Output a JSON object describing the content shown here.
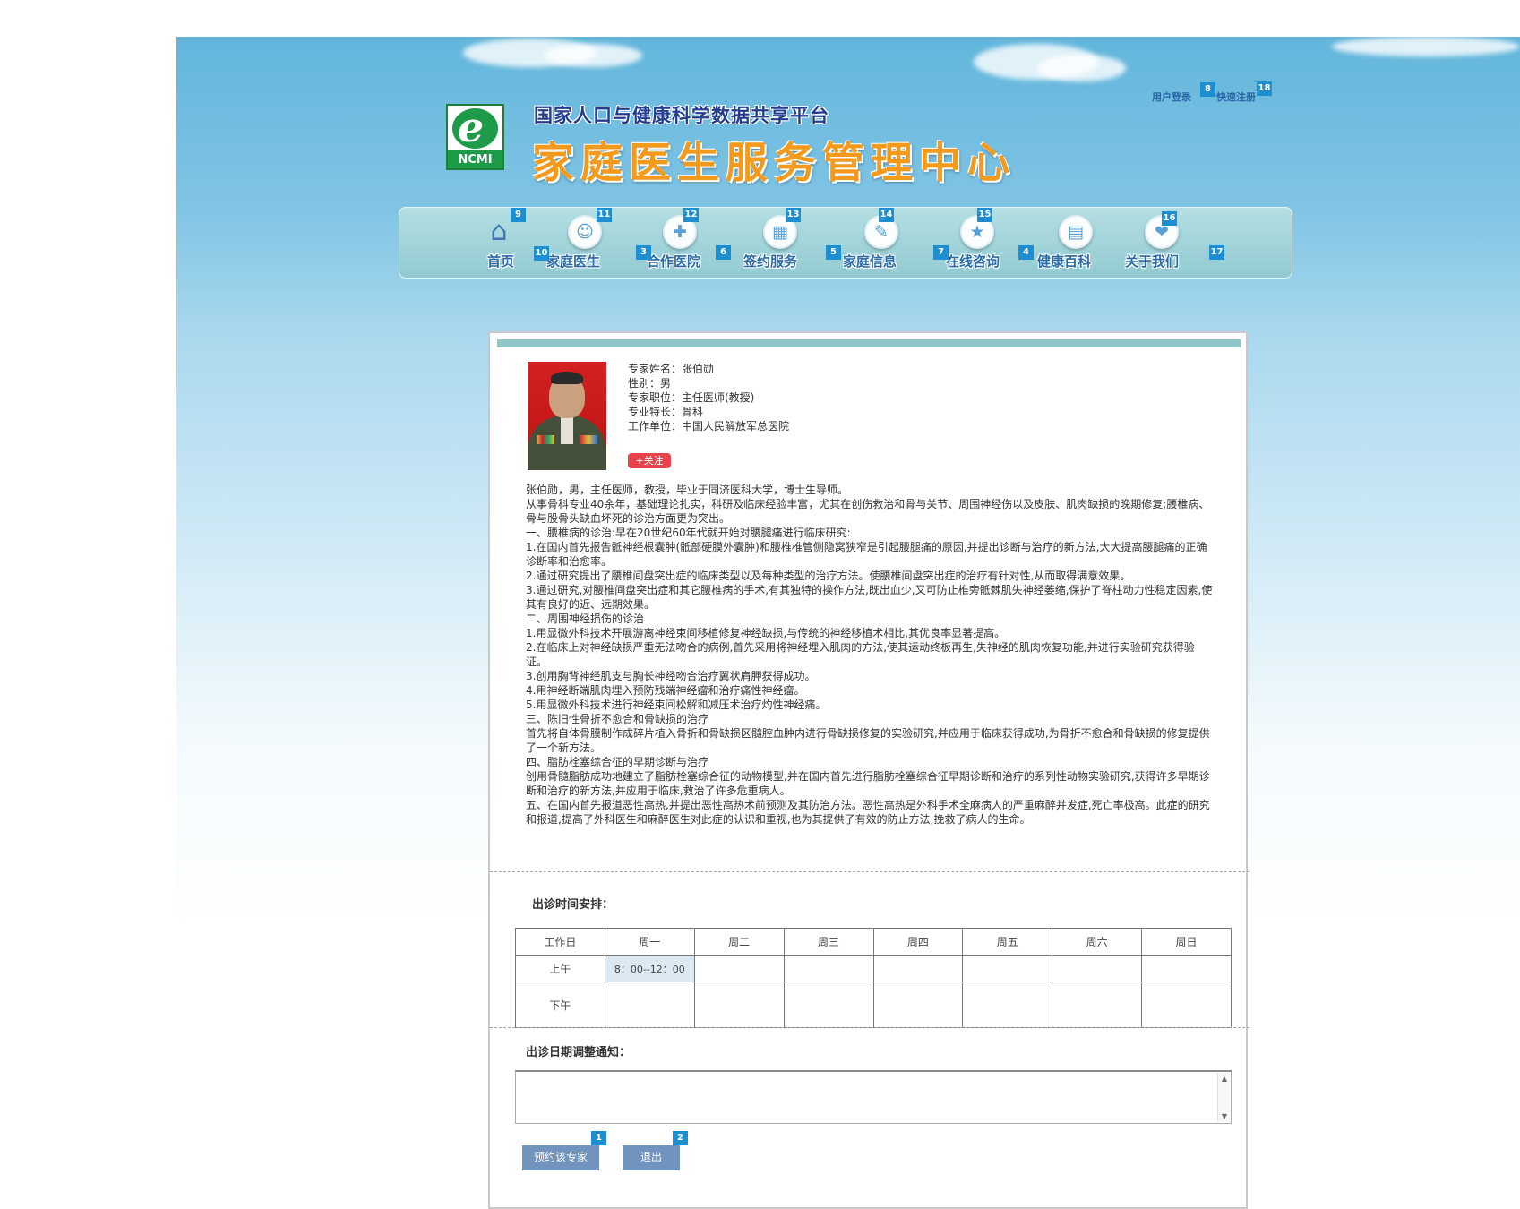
{
  "header": {
    "subtitle": "国家人口与健康科学数据共享平台",
    "title": "家庭医生服务管理中心",
    "logo_text": "NCMI",
    "login": "用户登录",
    "register": "快速注册"
  },
  "nav": [
    {
      "label": "首页",
      "icon": "home-icon"
    },
    {
      "label": "家庭医生",
      "icon": "doctor-icon"
    },
    {
      "label": "合作医院",
      "icon": "hospital-icon"
    },
    {
      "label": "签约服务",
      "icon": "calendar-icon"
    },
    {
      "label": "家庭信息",
      "icon": "family-info-icon"
    },
    {
      "label": "在线咨询",
      "icon": "consult-icon"
    },
    {
      "label": "健康百科",
      "icon": "book-icon"
    },
    {
      "label": "关于我们",
      "icon": "handshake-icon"
    }
  ],
  "markers": [
    "1",
    "2",
    "3",
    "4",
    "5",
    "6",
    "7",
    "8",
    "9",
    "10",
    "11",
    "12",
    "13",
    "14",
    "15",
    "16",
    "17",
    "18"
  ],
  "expert": {
    "name_line": "专家姓名：张伯勋",
    "gender_line": "性别：男",
    "title_line": "专家职位：主任医师(教授)",
    "specialty_line": "专业特长：骨科",
    "unit_line": "工作单位：中国人民解放军总医院",
    "follow": "+关注",
    "bio": "张伯勋，男，主任医师，教授，毕业于同济医科大学，博士生导师。\n从事骨科专业40余年，基础理论扎实，科研及临床经验丰富，尤其在创伤救治和骨与关节、周围神经伤以及皮肤、肌肉缺损的晚期修复;腰椎病、骨与股骨头缺血坏死的诊治方面更为突出。\n一、腰椎病的诊治:早在20世纪60年代就开始对腰腿痛进行临床研究:\n1.在国内首先报告骶神经根囊肿(骶部硬膜外囊肿)和腰椎椎管侧隐窝狭窄是引起腰腿痛的原因,并提出诊断与治疗的新方法,大大提高腰腿痛的正确诊断率和治愈率。\n2.通过研究提出了腰椎间盘突出症的临床类型以及每种类型的治疗方法。使腰椎间盘突出症的治疗有针对性,从而取得满意效果。\n3.通过研究,对腰椎间盘突出症和其它腰椎病的手术,有其独特的操作方法,既出血少,又可防止椎旁骶棘肌失神经萎缩,保护了脊柱动力性稳定因素,使其有良好的近、远期效果。\n二、周围神经损伤的诊治\n1.用显微外科技术开展游离神经束间移植修复神经缺损,与传统的神经移植术相比,其优良率显著提高。\n2.在临床上对神经缺损严重无法吻合的病例,首先采用将神经埋入肌肉的方法,使其运动终板再生,失神经的肌肉恢复功能,并进行实验研究获得验证。\n3.创用胸背神经肌支与胸长神经吻合治疗翼状肩胛获得成功。\n4.用神经断端肌肉埋入预防残端神经瘤和治疗痛性神经瘤。\n5.用显微外科技术进行神经束间松解和减压术治疗灼性神经痛。\n三、陈旧性骨折不愈合和骨缺损的治疗\n首先将自体骨膜制作成碎片植入骨折和骨缺损区髓腔血肿内进行骨缺损修复的实验研究,并应用于临床获得成功,为骨折不愈合和骨缺损的修复提供了一个新方法。\n四、脂肪栓塞综合征的早期诊断与治疗\n创用骨髓脂肪成功地建立了脂肪栓塞综合征的动物模型,并在国内首先进行脂肪栓塞综合征早期诊断和治疗的系列性动物实验研究,获得许多早期诊断和治疗的新方法,并应用于临床,救治了许多危重病人。\n五、在国内首先报道恶性高热,并提出恶性高热术前预测及其防治方法。恶性高热是外科手术全麻病人的严重麻醉并发症,死亡率极高。此症的研究和报道,提高了外科医生和麻醉医生对此症的认识和重视,也为其提供了有效的防止方法,挽救了病人的生命。"
  },
  "schedule": {
    "title": "出诊时间安排：",
    "headers": [
      "工作日",
      "周一",
      "周二",
      "周三",
      "周四",
      "周五",
      "周六",
      "周日"
    ],
    "rows": [
      [
        "上午",
        "8：00--12：00",
        "",
        "",
        "",
        "",
        "",
        ""
      ],
      [
        "下午",
        "",
        "",
        "",
        "",
        "",
        "",
        ""
      ]
    ]
  },
  "notice": {
    "title": "出诊日期调整通知：",
    "value": ""
  },
  "buttons": {
    "book": "预约该专家",
    "exit": "退出"
  },
  "colors": {
    "nav_bar": "#a3d4d9",
    "title_orange": "#f39a1d",
    "subtitle_blue": "#233c8f",
    "marker_blue": "#1d8fd1",
    "follow_red": "#e8434c",
    "button_blue": "#7094be"
  }
}
